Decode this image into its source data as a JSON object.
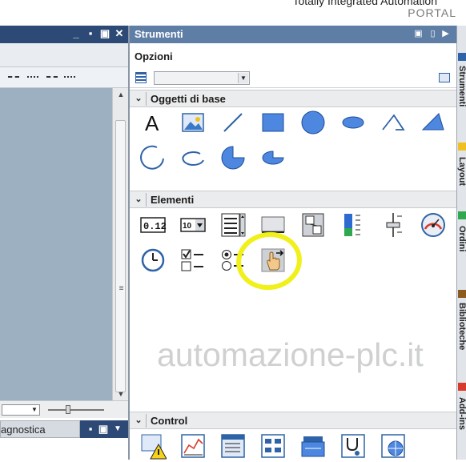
{
  "app": {
    "brand_title": "Totally Integrated Automation",
    "brand_portal": "PORTAL"
  },
  "left_pane": {
    "window_controls": [
      "_",
      "▪",
      "▣",
      "✕"
    ],
    "bottom_tab_label": "agnostica"
  },
  "tools_panel": {
    "title": "Strumenti",
    "options_label": "Opzioni",
    "sections": [
      {
        "label": "Oggetti di base",
        "expanded": true
      },
      {
        "label": "Elementi",
        "expanded": true
      },
      {
        "label": "Control",
        "expanded": true
      }
    ],
    "basic_objects": [
      "text",
      "graphic-view",
      "line",
      "rectangle",
      "circle",
      "ellipse",
      "polygon",
      "polyline",
      "arc",
      "elliptical-arc",
      "circle-segment",
      "elliptical-segment"
    ],
    "elements": [
      "io-field",
      "symbolic-io-field",
      "list",
      "button",
      "switch",
      "bar",
      "slider",
      "gauge",
      "clock",
      "checkbox",
      "radio-button",
      "touch-area"
    ],
    "controls": [
      "alarm-view",
      "trend-view",
      "user-view",
      "recipe-view",
      "data-view",
      "system-diagnostics-view",
      "web-browser"
    ]
  },
  "watermark": "automazione-plc.it",
  "side_tabs": [
    "Strumenti",
    "Layout",
    "Ordini",
    "Biblioteche",
    "Add-ins"
  ],
  "colors": {
    "title_bar_dark": "#2c4a75",
    "tools_title_bar": "#5f7ea6",
    "canvas": "#9db0c2",
    "highlight": "#f0f01a"
  }
}
